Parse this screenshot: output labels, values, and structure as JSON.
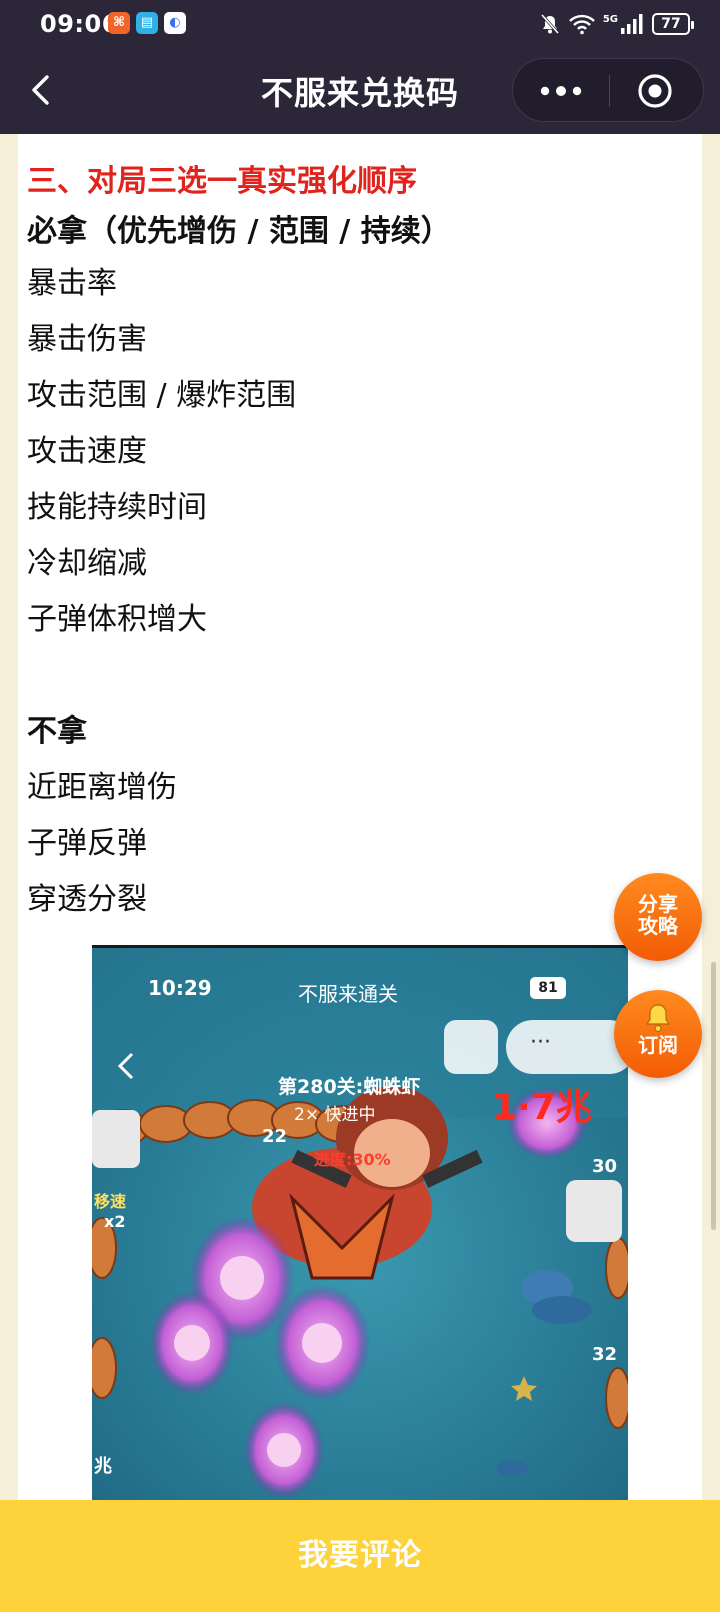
{
  "status_bar": {
    "time": "09:06",
    "battery": "77",
    "network": "5G"
  },
  "nav": {
    "title": "不服来兑换码",
    "more_icon": "more-dots-icon",
    "target_icon": "target-icon"
  },
  "article": {
    "section_title": "三、对局三选一真实强化顺序",
    "must_take_heading": "必拿（优先增伤 / 范围 / 持续）",
    "must_take_items": [
      "暴击率",
      "暴击伤害",
      "攻击范围 / 爆炸范围",
      "攻击速度",
      "技能持续时间",
      "冷却缩减",
      "子弹体积增大"
    ],
    "skip_heading": "不拿",
    "skip_items": [
      "近距离增伤",
      "子弹反弹",
      "穿透分裂"
    ]
  },
  "embedded_screenshot": {
    "time": "10:29",
    "title": "不服来通关",
    "battery": "81",
    "level_label": "第280关:蜘蛛虾",
    "speed_label": "2× 快进中",
    "progress_label": "进度:30%",
    "score_label": "1·7兆",
    "buff_label": "移速",
    "buff_mult": "x2",
    "side_numbers": [
      "22",
      "30",
      "32"
    ],
    "coin_label": "兆"
  },
  "fab": {
    "share_line1": "分享",
    "share_line2": "攻略",
    "subscribe_label": "订阅"
  },
  "bottom": {
    "comment_label": "我要评论"
  },
  "colors": {
    "header_bg": "#2b2738",
    "accent_red": "#e0231c",
    "fab_orange": "#f25c05",
    "bottom_yellow": "#fdd23a"
  }
}
